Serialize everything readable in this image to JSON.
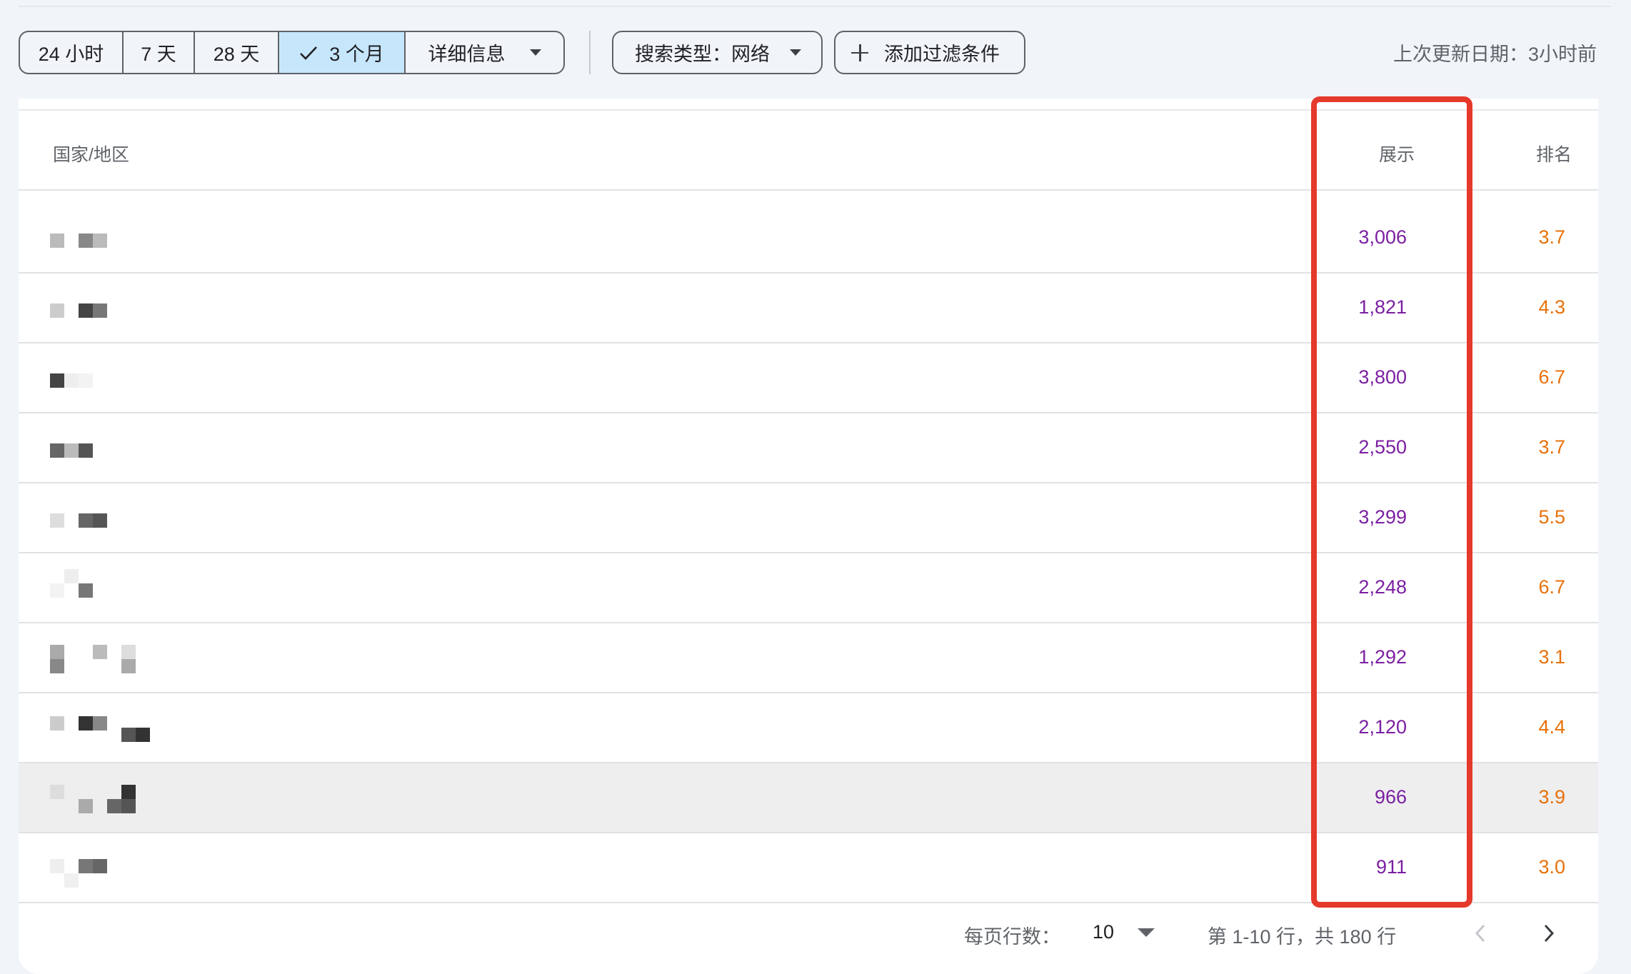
{
  "filters": {
    "ranges": [
      {
        "label": "24 小时",
        "selected": false
      },
      {
        "label": "7 天",
        "selected": false
      },
      {
        "label": "28 天",
        "selected": false
      },
      {
        "label": "3 个月",
        "selected": true
      }
    ],
    "details_label": "详细信息",
    "search_type_label": "搜索类型：网络",
    "add_filter_label": "添加过滤条件",
    "last_updated": "上次更新日期：3小时前"
  },
  "table": {
    "columns": {
      "country": "国家/地区",
      "impressions": "展示",
      "rank": "排名"
    },
    "rows": [
      {
        "country": "",
        "impressions": "3,006",
        "rank": "3.7"
      },
      {
        "country": "",
        "impressions": "1,821",
        "rank": "4.3"
      },
      {
        "country": "",
        "impressions": "3,800",
        "rank": "6.7"
      },
      {
        "country": "",
        "impressions": "2,550",
        "rank": "3.7"
      },
      {
        "country": "",
        "impressions": "3,299",
        "rank": "5.5"
      },
      {
        "country": "",
        "impressions": "2,248",
        "rank": "6.7"
      },
      {
        "country": "",
        "impressions": "1,292",
        "rank": "3.1"
      },
      {
        "country": "",
        "impressions": "2,120",
        "rank": "4.4"
      },
      {
        "country": "",
        "impressions": "966",
        "rank": "3.9"
      },
      {
        "country": "",
        "impressions": "911",
        "rank": "3.0"
      }
    ]
  },
  "pagination": {
    "rows_per_page_label": "每页行数：",
    "rows_per_page": "10",
    "range_text": "第 1-10 行，共 180 行"
  },
  "colors": {
    "impressions": "#7b1fa2",
    "rank": "#e8710a",
    "highlight": "#e5392b",
    "selected": "#c6e6fb"
  }
}
